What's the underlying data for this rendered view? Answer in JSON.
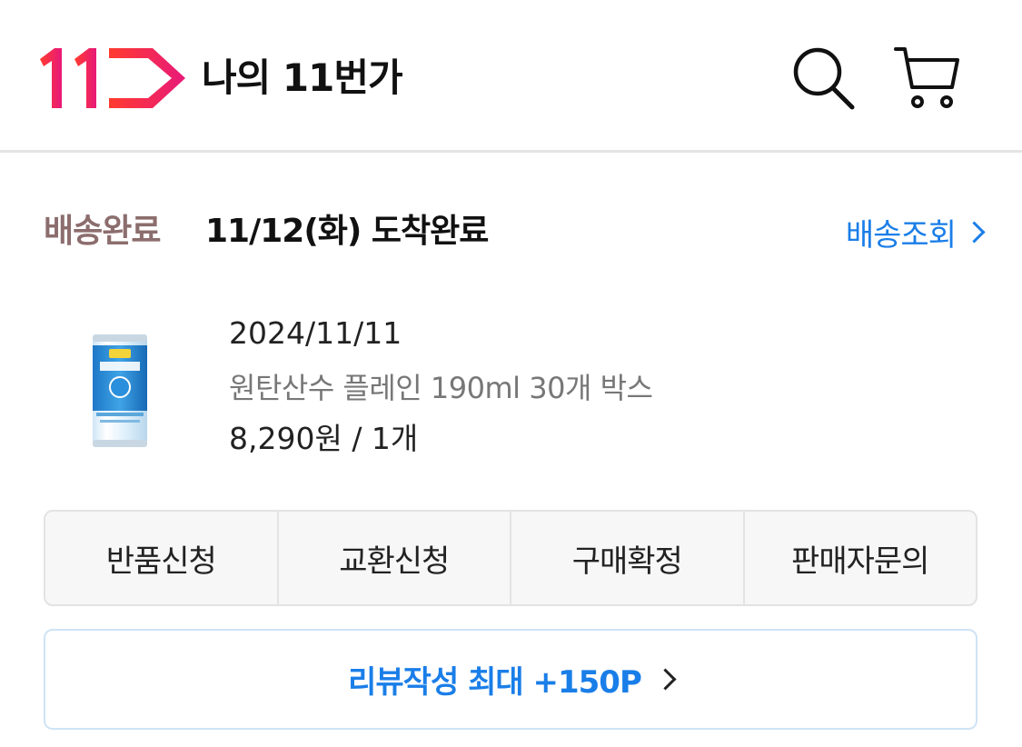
{
  "header": {
    "title": "나의 11번가",
    "logo_icon": "11st-logo",
    "search_icon": "search-icon",
    "cart_icon": "cart-icon",
    "brand_colors": {
      "logo_start": "#ff3b2f",
      "logo_end": "#e8197a"
    }
  },
  "delivery": {
    "status_label": "배송완료",
    "status_detail": "11/12(화) 도착완료",
    "track_label": "배송조회",
    "status_color": "#8c6d6d",
    "link_color": "#1a7ee8"
  },
  "product": {
    "order_date": "2024/11/11",
    "name": "원탄산수 플레인 190ml 30개 박스",
    "price_qty": "8,290원 / 1개",
    "thumbnail_icon": "soda-can-thumbnail"
  },
  "actions": [
    {
      "label": "반품신청"
    },
    {
      "label": "교환신청"
    },
    {
      "label": "구매확정"
    },
    {
      "label": "판매자문의"
    }
  ],
  "review": {
    "label": "리뷰작성 최대 +150P",
    "color": "#1a7ee8"
  }
}
